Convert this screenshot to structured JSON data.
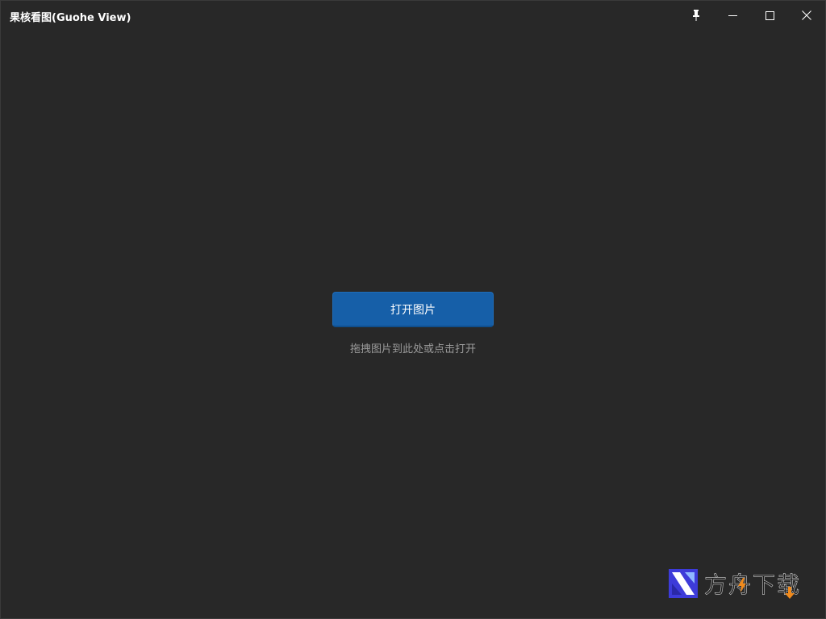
{
  "window": {
    "title": "果核看图(Guohe View)",
    "controls": {
      "pin": "pin-icon",
      "minimize": "minimize-icon",
      "maximize": "maximize-icon",
      "close": "close-icon"
    }
  },
  "main": {
    "open_button_label": "打开图片",
    "hint_text": "拖拽图片到此处或点击打开"
  },
  "watermark": {
    "text": "方舟下载"
  },
  "colors": {
    "background": "#282828",
    "accent": "#165fa8",
    "hint": "#9a9a9a",
    "watermark_orange": "#f08a1c",
    "watermark_blue": "#3d3bd9"
  }
}
